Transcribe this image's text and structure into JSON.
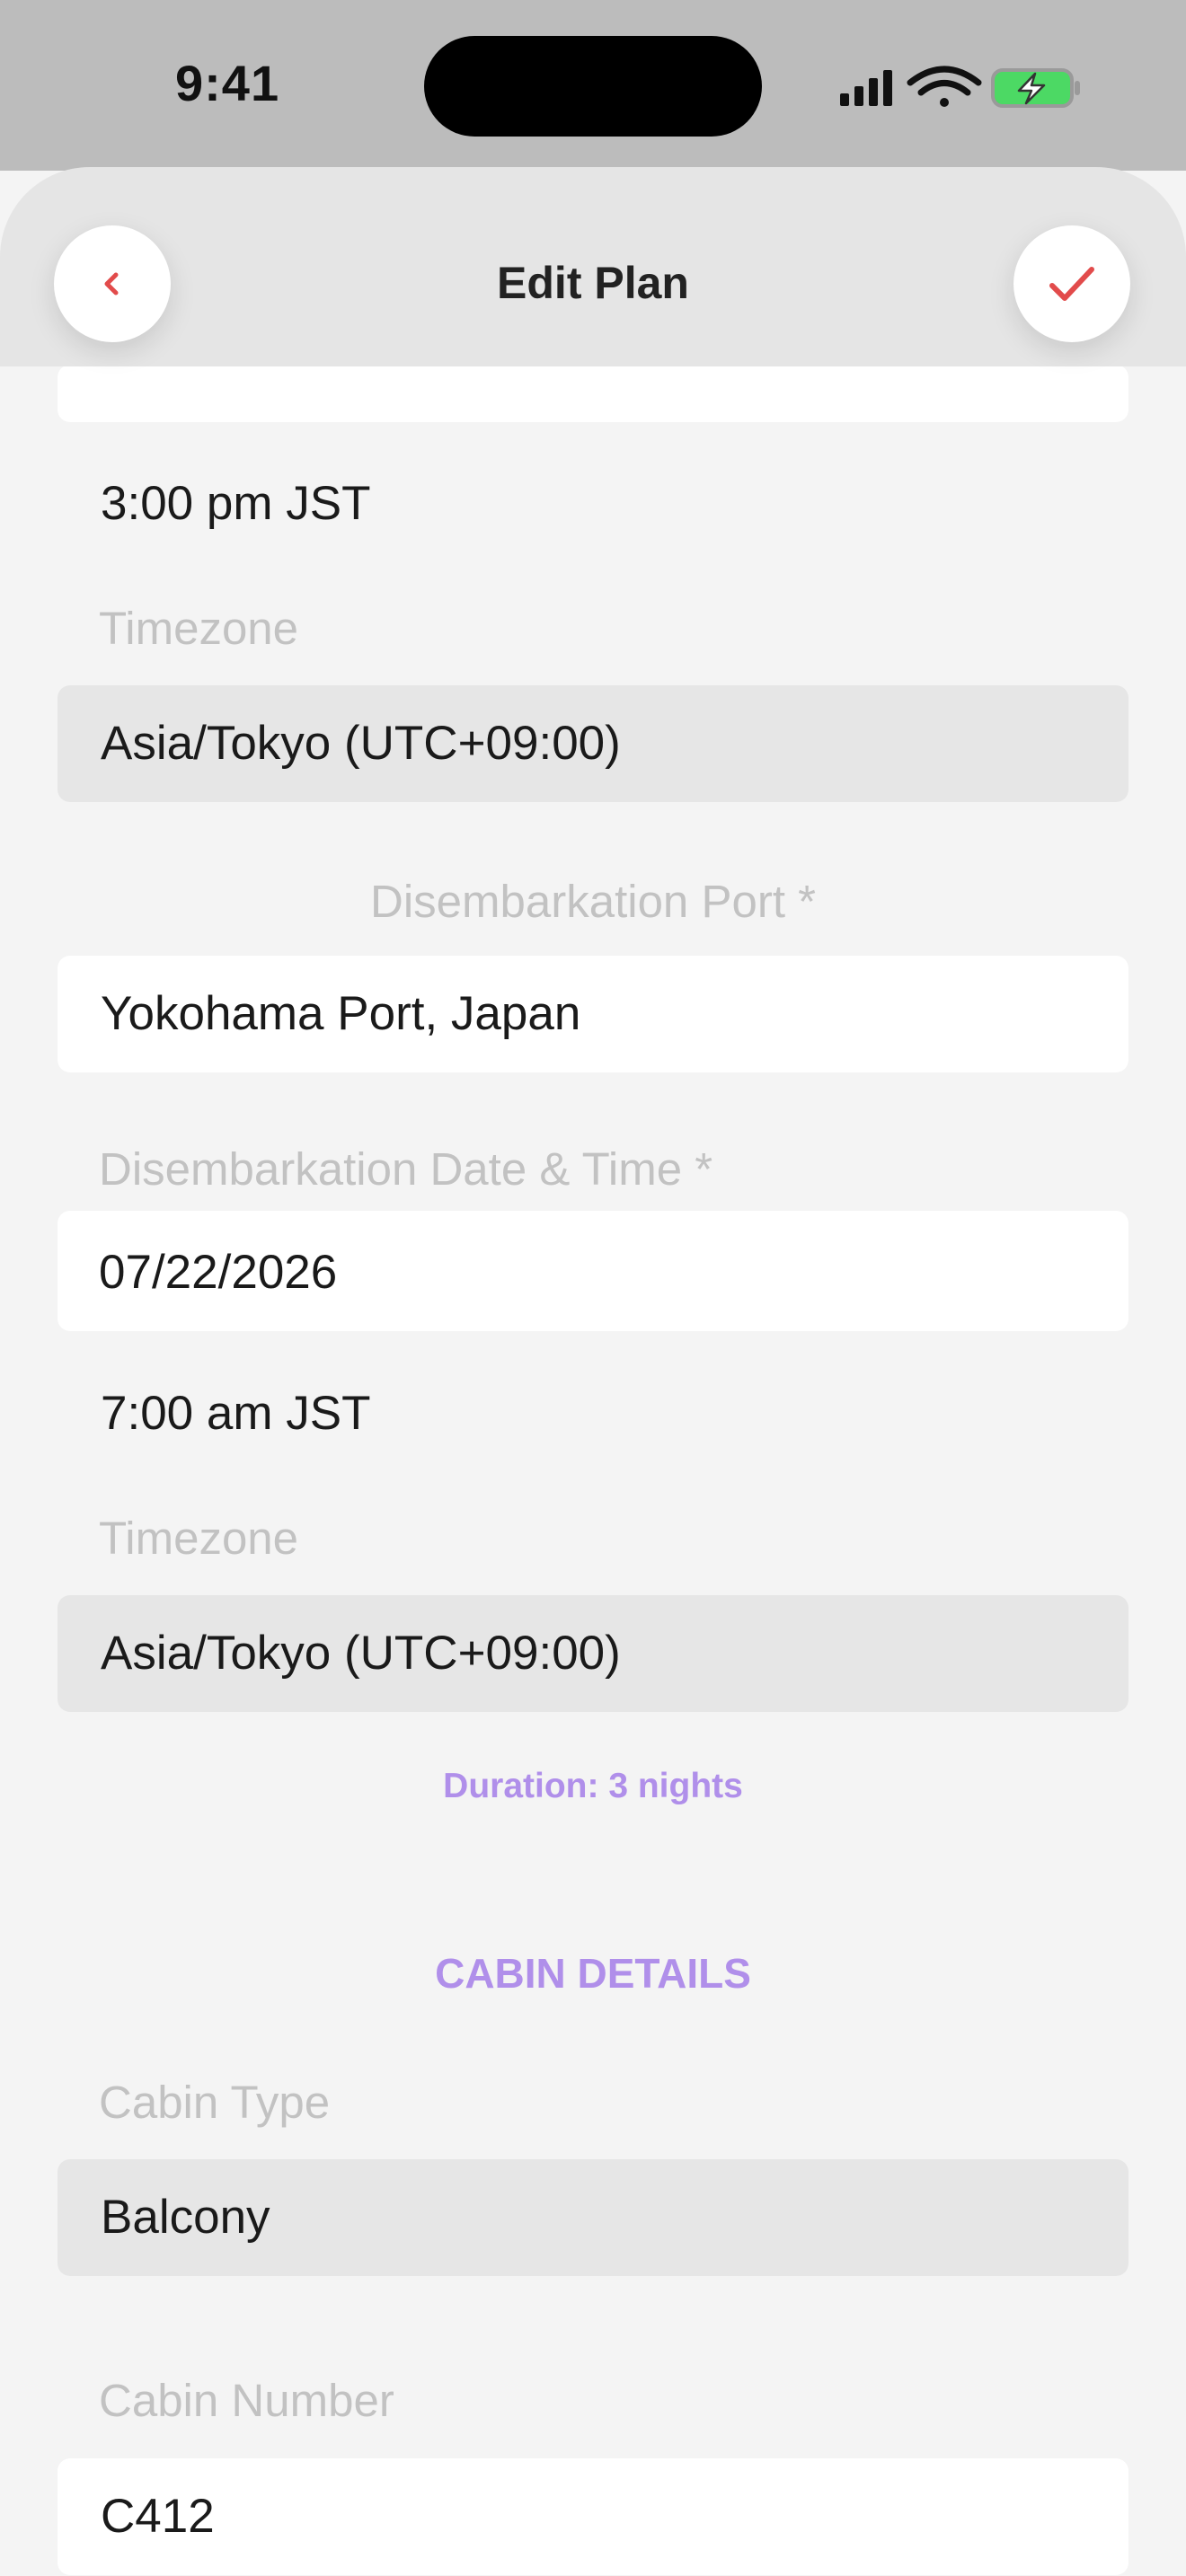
{
  "status_bar": {
    "time": "9:41"
  },
  "header": {
    "title": "Edit Plan",
    "back_icon": "chevron-left-icon",
    "save_icon": "check-icon",
    "accent_color": "#e24b4b"
  },
  "embarkation": {
    "time": "3:00 pm JST",
    "timezone_label": "Timezone",
    "timezone": "Asia/Tokyo (UTC+09:00)"
  },
  "disembarkation": {
    "port_label": "Disembarkation Port *",
    "port": "Yokohama Port, Japan",
    "datetime_label": "Disembarkation Date & Time *",
    "date": "07/22/2026",
    "time": "7:00 am JST",
    "timezone_label": "Timezone",
    "timezone": "Asia/Tokyo (UTC+09:00)"
  },
  "duration": "Duration: 3 nights",
  "cabin": {
    "section_title": "CABIN DETAILS",
    "type_label": "Cabin Type",
    "type": "Balcony",
    "number_label": "Cabin Number",
    "number": "C412"
  },
  "colors": {
    "accent_purple": "#b08fea",
    "label_grey": "#c2c2c2"
  }
}
